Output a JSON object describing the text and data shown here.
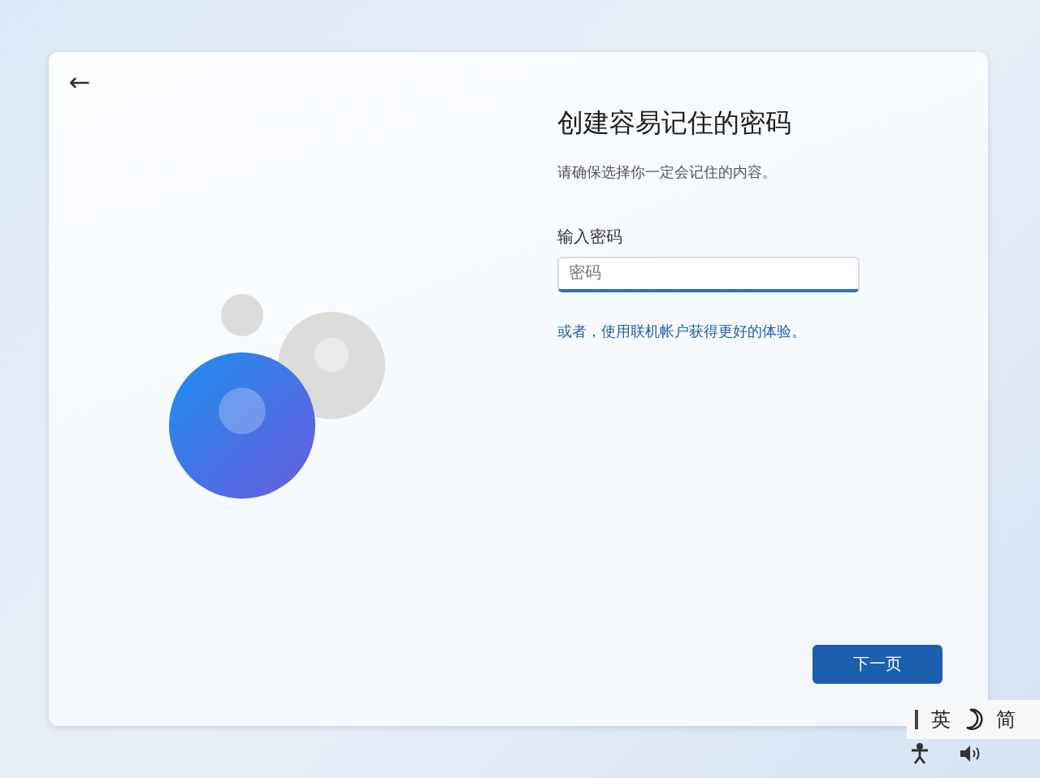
{
  "back_button": {
    "label": "←"
  },
  "heading": "创建容易记住的密码",
  "subtitle": "请确保选择你一定会记住的内容。",
  "password_field": {
    "label": "输入密码",
    "placeholder": "密码"
  },
  "alternative_link": "或者，使用联机帐户获得更好的体验。",
  "next_button": {
    "label": "下一页"
  },
  "ime_bar": {
    "items": [
      {
        "kind": "text",
        "label": "英"
      },
      {
        "kind": "moon"
      },
      {
        "kind": "text",
        "label": "简"
      }
    ]
  }
}
